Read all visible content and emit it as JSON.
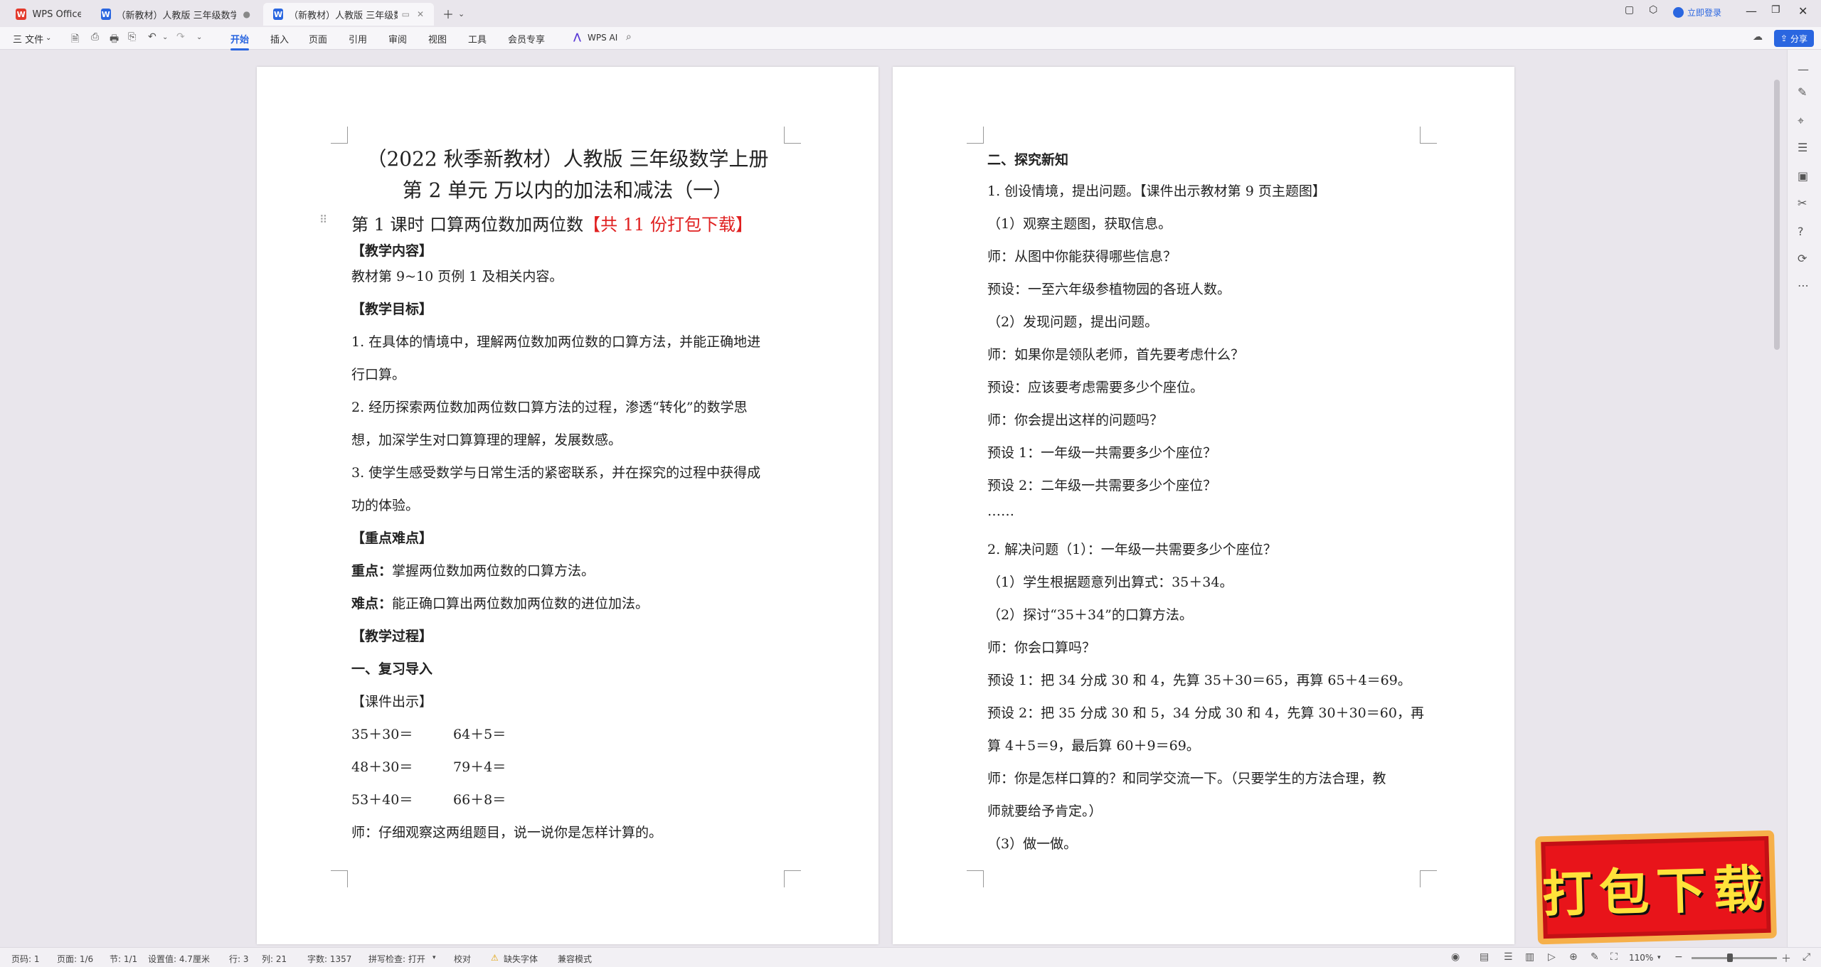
{
  "tabs": [
    {
      "label": "WPS Office",
      "icon": "wps-logo-icon"
    },
    {
      "label": "（新教材）人教版 三年级数学上册",
      "icon": "word-doc-icon"
    },
    {
      "label": "（新教材）人教版 三年级数学",
      "icon": "word-doc-icon"
    }
  ],
  "titlebar": {
    "login_label": "立即登录"
  },
  "menu": {
    "file_label": "三 文件",
    "tabs": [
      "开始",
      "插入",
      "页面",
      "引用",
      "审阅",
      "视图",
      "工具",
      "会员专享"
    ],
    "active_tab": "开始",
    "ai_label": "WPS AI",
    "share_label": "分享"
  },
  "page1": {
    "title_line1": "（2022 秋季新教材）人教版 三年级数学上册",
    "title_line2": "第 2 单元 万以内的加法和减法（一）",
    "lesson_prefix": "第 1 课时      口算两位数加两位数",
    "lesson_red": "【共 11 份打包下载】",
    "lines": [
      "【教学内容】",
      "教材第 9~10 页例 1 及相关内容。",
      "【教学目标】",
      "1. 在具体的情境中，理解两位数加两位数的口算方法，并能正确地进",
      "行口算。",
      "2. 经历探索两位数加两位数口算方法的过程，渗透“转化”的数学思",
      "想，加深学生对口算算理的理解，发展数感。",
      "3. 使学生感受数学与日常生活的紧密联系，并在探究的过程中获得成",
      "功的体验。",
      "【重点难点】"
    ],
    "key_point_label": "重点：",
    "key_point_text": "掌握两位数加两位数的口算方法。",
    "difficulty_label": "难点：",
    "difficulty_text": "能正确口算出两位数加两位数的进位加法。",
    "process_heading": "【教学过程】",
    "section1_heading": "一、复习导入",
    "courseware_label": "【课件出示】",
    "exercises": [
      [
        "35＋30＝",
        "64＋5＝"
      ],
      [
        "48＋30＝",
        "79＋4＝"
      ],
      [
        "53＋40＝",
        "66＋8＝"
      ]
    ],
    "last_line": "师：仔细观察这两组题目，说一说你是怎样计算的。"
  },
  "page2": {
    "heading": "二、探究新知",
    "lines": [
      "1. 创设情境，提出问题。【课件出示教材第 9 页主题图】",
      "（1）观察主题图，获取信息。",
      "师：从图中你能获得哪些信息？",
      "预设：一至六年级参植物园的各班人数。",
      "（2）发现问题，提出问题。",
      "师：如果你是领队老师，首先要考虑什么？",
      "预设：应该要考虑需要多少个座位。",
      "师：你会提出这样的问题吗？",
      "预设 1：一年级一共需要多少个座位？",
      "预设 2：二年级一共需要多少个座位？",
      "……",
      "2. 解决问题（1）：一年级一共需要多少个座位？",
      "（1）学生根据题意列出算式：35＋34。",
      "（2）探讨“35＋34”的口算方法。",
      "师：你会口算吗？",
      "预设 1：把 34 分成 30 和 4，先算 35＋30＝65，再算 65＋4＝69。",
      "预设 2：把 35 分成 30 和 5，34 分成 30 和 4，先算 30＋30＝60，再",
      "算 4＋5＝9，最后算 60＋9＝69。",
      "师：你是怎样口算的？和同学交流一下。（只要学生的方法合理，教",
      "师就要给予肯定。）",
      "（3）做一做。"
    ]
  },
  "status": {
    "page_num": "页码: 1",
    "page_of": "页面: 1/6",
    "section": "节: 1/1",
    "position": "设置值: 4.7厘米",
    "row": "行: 3",
    "col": "列: 21",
    "words": "字数: 1357",
    "spell": "拼写检查: 打开",
    "proofread": "校对",
    "missing_font": "缺失字体",
    "compat": "兼容模式",
    "zoom": "110%"
  },
  "promo": {
    "text": "打包下载"
  }
}
